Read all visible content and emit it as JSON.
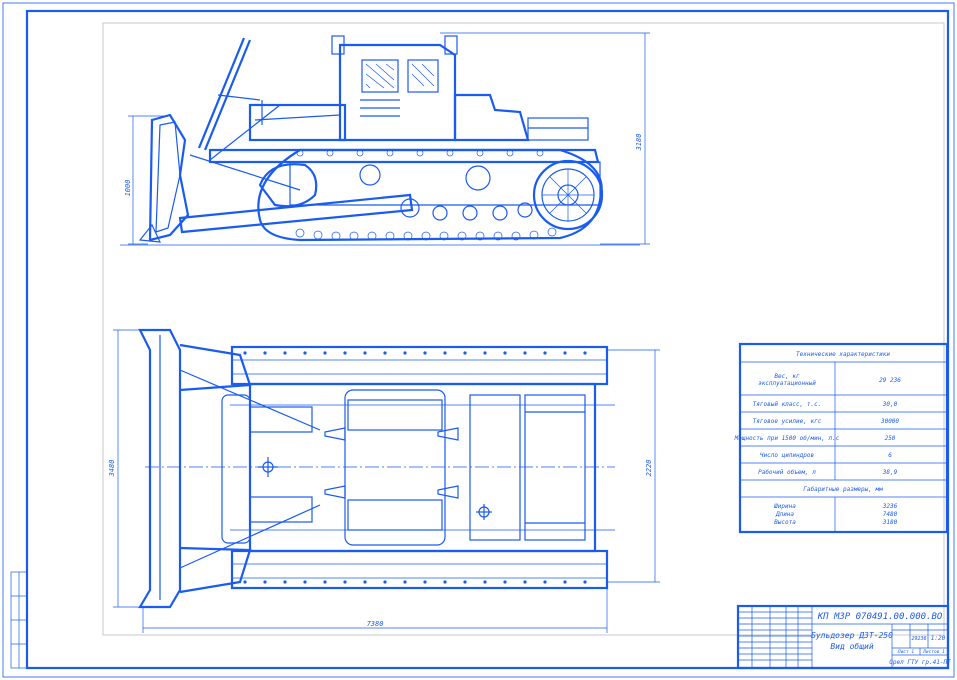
{
  "drawing": {
    "dimensions": {
      "side_blade_height": "1000",
      "side_total_height": "3180",
      "top_blade_width": "3480",
      "top_track_width": "2220",
      "top_total_length": "7380"
    }
  },
  "spec_table": {
    "title": "Технические характеристики",
    "rows": [
      {
        "label": "Вес, кг\nэксплуатационный",
        "value": "29 236"
      },
      {
        "label": "Тяговый класс, т.с.",
        "value": "30,0"
      },
      {
        "label": "Тяговое усилие, кгс",
        "value": "30000"
      },
      {
        "label": "Мощность при 1500 об/мин, л.с",
        "value": "250"
      },
      {
        "label": "Число цилиндров",
        "value": "6"
      },
      {
        "label": "Рабочий объем, л",
        "value": "38,9"
      }
    ],
    "dims_title": "Габаритные размеры, мм",
    "dims": {
      "labels": [
        "Ширина",
        "Длина",
        "Высота"
      ],
      "values": [
        "3236",
        "7480",
        "3180"
      ]
    }
  },
  "title_block": {
    "doc_code": "КП МЗР 070491.00.000.ВО",
    "name_line1": "Бульдозер ДЗТ-250",
    "name_line2": "Вид общий",
    "mass": "29236",
    "scale": "1:20",
    "sheet_label": "Лист 1",
    "sheets_label": "Листов 1",
    "org": "Орел ГТУ гр.41-ПТ"
  }
}
